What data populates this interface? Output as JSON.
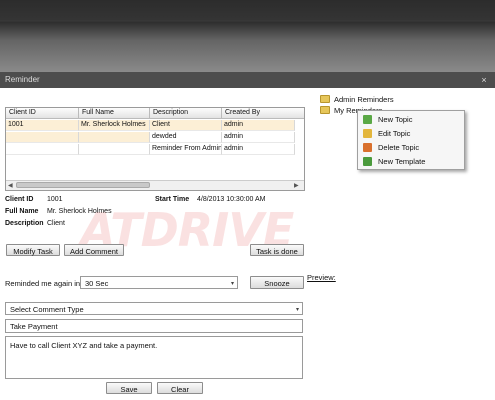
{
  "window": {
    "title": "Reminder",
    "close_glyph": "×"
  },
  "grid": {
    "columns": [
      "Client ID",
      "Full Name",
      "Description",
      "Created By"
    ],
    "rows": [
      [
        "1001",
        "Mr. Sherlock Holmes",
        "Client",
        "admin"
      ],
      [
        "",
        "",
        "dewded",
        "admin"
      ],
      [
        "",
        "",
        "Reminder From Admin",
        "admin"
      ]
    ]
  },
  "details": {
    "client_id_label": "Client ID",
    "client_id_value": "1001",
    "start_time_label": "Start Time",
    "start_time_value": "4/8/2013 10:30:00 AM",
    "full_name_label": "Full Name",
    "full_name_value": "Mr. Sherlock Holmes",
    "description_label": "Description",
    "description_value": "Client"
  },
  "buttons": {
    "modify_task": "Modify Task",
    "add_comment": "Add Comment",
    "task_done": "Task is done",
    "snooze": "Snooze",
    "save": "Save",
    "clear": "Clear"
  },
  "remind": {
    "label": "Reminded me again in",
    "value": "30 Sec",
    "preview_label": "Preview:"
  },
  "comment": {
    "type_placeholder": "Select Comment Type",
    "subject": "Take Payment",
    "body": "Have to call Client XYZ and take a payment."
  },
  "tree": {
    "items": [
      "Admin Reminders",
      "My Reminders"
    ]
  },
  "context_menu": {
    "items": [
      {
        "label": "New Topic",
        "icon": "new-topic-icon",
        "color": "#5aa845"
      },
      {
        "label": "Edit Topic",
        "icon": "edit-topic-icon",
        "color": "#e3b63c"
      },
      {
        "label": "Delete Topic",
        "icon": "delete-topic-icon",
        "color": "#d9702d"
      },
      {
        "label": "New Template",
        "icon": "new-template-icon",
        "color": "#4a9a3c"
      }
    ]
  },
  "watermark": "ATDRIVE"
}
